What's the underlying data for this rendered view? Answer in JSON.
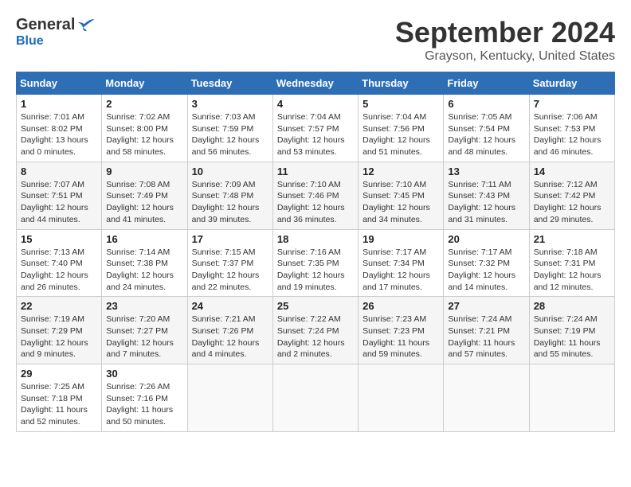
{
  "header": {
    "logo_general": "General",
    "logo_blue": "Blue",
    "month_title": "September 2024",
    "location": "Grayson, Kentucky, United States"
  },
  "weekdays": [
    "Sunday",
    "Monday",
    "Tuesday",
    "Wednesday",
    "Thursday",
    "Friday",
    "Saturday"
  ],
  "weeks": [
    [
      {
        "day": "1",
        "info": "Sunrise: 7:01 AM\nSunset: 8:02 PM\nDaylight: 13 hours\nand 0 minutes."
      },
      {
        "day": "2",
        "info": "Sunrise: 7:02 AM\nSunset: 8:00 PM\nDaylight: 12 hours\nand 58 minutes."
      },
      {
        "day": "3",
        "info": "Sunrise: 7:03 AM\nSunset: 7:59 PM\nDaylight: 12 hours\nand 56 minutes."
      },
      {
        "day": "4",
        "info": "Sunrise: 7:04 AM\nSunset: 7:57 PM\nDaylight: 12 hours\nand 53 minutes."
      },
      {
        "day": "5",
        "info": "Sunrise: 7:04 AM\nSunset: 7:56 PM\nDaylight: 12 hours\nand 51 minutes."
      },
      {
        "day": "6",
        "info": "Sunrise: 7:05 AM\nSunset: 7:54 PM\nDaylight: 12 hours\nand 48 minutes."
      },
      {
        "day": "7",
        "info": "Sunrise: 7:06 AM\nSunset: 7:53 PM\nDaylight: 12 hours\nand 46 minutes."
      }
    ],
    [
      {
        "day": "8",
        "info": "Sunrise: 7:07 AM\nSunset: 7:51 PM\nDaylight: 12 hours\nand 44 minutes."
      },
      {
        "day": "9",
        "info": "Sunrise: 7:08 AM\nSunset: 7:49 PM\nDaylight: 12 hours\nand 41 minutes."
      },
      {
        "day": "10",
        "info": "Sunrise: 7:09 AM\nSunset: 7:48 PM\nDaylight: 12 hours\nand 39 minutes."
      },
      {
        "day": "11",
        "info": "Sunrise: 7:10 AM\nSunset: 7:46 PM\nDaylight: 12 hours\nand 36 minutes."
      },
      {
        "day": "12",
        "info": "Sunrise: 7:10 AM\nSunset: 7:45 PM\nDaylight: 12 hours\nand 34 minutes."
      },
      {
        "day": "13",
        "info": "Sunrise: 7:11 AM\nSunset: 7:43 PM\nDaylight: 12 hours\nand 31 minutes."
      },
      {
        "day": "14",
        "info": "Sunrise: 7:12 AM\nSunset: 7:42 PM\nDaylight: 12 hours\nand 29 minutes."
      }
    ],
    [
      {
        "day": "15",
        "info": "Sunrise: 7:13 AM\nSunset: 7:40 PM\nDaylight: 12 hours\nand 26 minutes."
      },
      {
        "day": "16",
        "info": "Sunrise: 7:14 AM\nSunset: 7:38 PM\nDaylight: 12 hours\nand 24 minutes."
      },
      {
        "day": "17",
        "info": "Sunrise: 7:15 AM\nSunset: 7:37 PM\nDaylight: 12 hours\nand 22 minutes."
      },
      {
        "day": "18",
        "info": "Sunrise: 7:16 AM\nSunset: 7:35 PM\nDaylight: 12 hours\nand 19 minutes."
      },
      {
        "day": "19",
        "info": "Sunrise: 7:17 AM\nSunset: 7:34 PM\nDaylight: 12 hours\nand 17 minutes."
      },
      {
        "day": "20",
        "info": "Sunrise: 7:17 AM\nSunset: 7:32 PM\nDaylight: 12 hours\nand 14 minutes."
      },
      {
        "day": "21",
        "info": "Sunrise: 7:18 AM\nSunset: 7:31 PM\nDaylight: 12 hours\nand 12 minutes."
      }
    ],
    [
      {
        "day": "22",
        "info": "Sunrise: 7:19 AM\nSunset: 7:29 PM\nDaylight: 12 hours\nand 9 minutes."
      },
      {
        "day": "23",
        "info": "Sunrise: 7:20 AM\nSunset: 7:27 PM\nDaylight: 12 hours\nand 7 minutes."
      },
      {
        "day": "24",
        "info": "Sunrise: 7:21 AM\nSunset: 7:26 PM\nDaylight: 12 hours\nand 4 minutes."
      },
      {
        "day": "25",
        "info": "Sunrise: 7:22 AM\nSunset: 7:24 PM\nDaylight: 12 hours\nand 2 minutes."
      },
      {
        "day": "26",
        "info": "Sunrise: 7:23 AM\nSunset: 7:23 PM\nDaylight: 11 hours\nand 59 minutes."
      },
      {
        "day": "27",
        "info": "Sunrise: 7:24 AM\nSunset: 7:21 PM\nDaylight: 11 hours\nand 57 minutes."
      },
      {
        "day": "28",
        "info": "Sunrise: 7:24 AM\nSunset: 7:19 PM\nDaylight: 11 hours\nand 55 minutes."
      }
    ],
    [
      {
        "day": "29",
        "info": "Sunrise: 7:25 AM\nSunset: 7:18 PM\nDaylight: 11 hours\nand 52 minutes."
      },
      {
        "day": "30",
        "info": "Sunrise: 7:26 AM\nSunset: 7:16 PM\nDaylight: 11 hours\nand 50 minutes."
      },
      {
        "day": "",
        "info": ""
      },
      {
        "day": "",
        "info": ""
      },
      {
        "day": "",
        "info": ""
      },
      {
        "day": "",
        "info": ""
      },
      {
        "day": "",
        "info": ""
      }
    ]
  ]
}
